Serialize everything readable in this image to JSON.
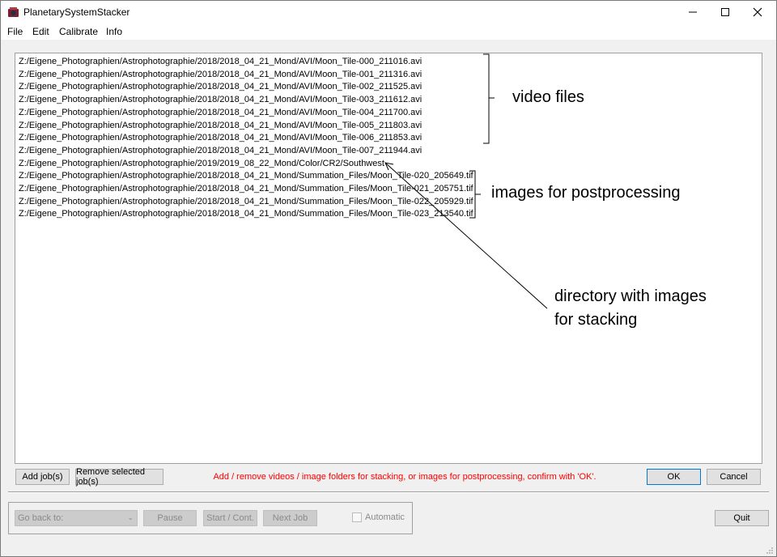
{
  "window": {
    "title": "PlanetarySystemStacker"
  },
  "menu": [
    "File",
    "Edit",
    "Calibrate",
    "Info"
  ],
  "jobs": [
    "Z:/Eigene_Photographien/Astrophotographie/2018/2018_04_21_Mond/AVI/Moon_Tile-000_211016.avi",
    "Z:/Eigene_Photographien/Astrophotographie/2018/2018_04_21_Mond/AVI/Moon_Tile-001_211316.avi",
    "Z:/Eigene_Photographien/Astrophotographie/2018/2018_04_21_Mond/AVI/Moon_Tile-002_211525.avi",
    "Z:/Eigene_Photographien/Astrophotographie/2018/2018_04_21_Mond/AVI/Moon_Tile-003_211612.avi",
    "Z:/Eigene_Photographien/Astrophotographie/2018/2018_04_21_Mond/AVI/Moon_Tile-004_211700.avi",
    "Z:/Eigene_Photographien/Astrophotographie/2018/2018_04_21_Mond/AVI/Moon_Tile-005_211803.avi",
    "Z:/Eigene_Photographien/Astrophotographie/2018/2018_04_21_Mond/AVI/Moon_Tile-006_211853.avi",
    "Z:/Eigene_Photographien/Astrophotographie/2018/2018_04_21_Mond/AVI/Moon_Tile-007_211944.avi",
    "Z:/Eigene_Photographien/Astrophotographie/2019/2019_08_22_Mond/Color/CR2/Southwest",
    "Z:/Eigene_Photographien/Astrophotographie/2018/2018_04_21_Mond/Summation_Files/Moon_Tile-020_205649.tif",
    "Z:/Eigene_Photographien/Astrophotographie/2018/2018_04_21_Mond/Summation_Files/Moon_Tile-021_205751.tif",
    "Z:/Eigene_Photographien/Astrophotographie/2018/2018_04_21_Mond/Summation_Files/Moon_Tile-022_205929.tif",
    "Z:/Eigene_Photographien/Astrophotographie/2018/2018_04_21_Mond/Summation_Files/Moon_Tile-023_213540.tif"
  ],
  "buttons": {
    "add": "Add job(s)",
    "remove": "Remove selected job(s)",
    "ok": "OK",
    "cancel": "Cancel",
    "pause": "Pause",
    "start": "Start / Cont.",
    "next": "Next Job",
    "quit": "Quit"
  },
  "hint": "Add / remove videos / image folders for stacking, or images for postprocessing, confirm with 'OK'.",
  "go_back": {
    "placeholder": "Go back to:"
  },
  "automatic": {
    "label": "Automatic",
    "checked": false
  },
  "annotations": {
    "video": "video files",
    "images": "images for postprocessing",
    "dir_line1": "directory with images",
    "dir_line2": "for stacking"
  },
  "colors": {
    "hint": "#ff0000",
    "default_button_border": "#0078d7"
  },
  "icons": [
    "app-icon",
    "minimize-icon",
    "maximize-icon",
    "close-icon",
    "chevron-down-icon",
    "resize-grip-icon"
  ]
}
